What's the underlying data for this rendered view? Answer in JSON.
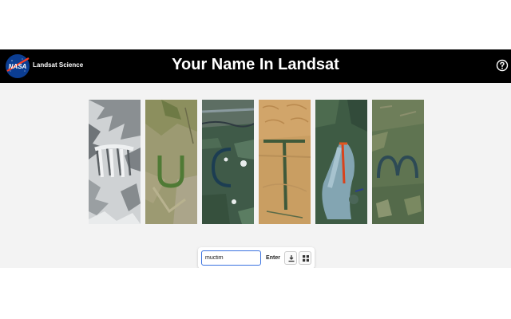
{
  "header": {
    "site_name": "Landsat Science",
    "title": "Your Name In Landsat",
    "logo_text": "NASA",
    "help_icon": "question-circle-icon"
  },
  "letters": [
    {
      "letter": "M",
      "scene": "glacier"
    },
    {
      "letter": "U",
      "scene": "grassland"
    },
    {
      "letter": "C",
      "scene": "river-meander"
    },
    {
      "letter": "T",
      "scene": "desert"
    },
    {
      "letter": "I",
      "scene": "wildfire-smoke"
    },
    {
      "letter": "M",
      "scene": "river-meander-valley"
    }
  ],
  "controls": {
    "name_value": "muctim",
    "enter_label": "Enter",
    "download_icon": "download-icon",
    "layout_icon": "grid-icon"
  },
  "colors": {
    "header_bg": "#000000",
    "content_bg": "#f3f3f3",
    "input_border": "#3b73e0"
  }
}
